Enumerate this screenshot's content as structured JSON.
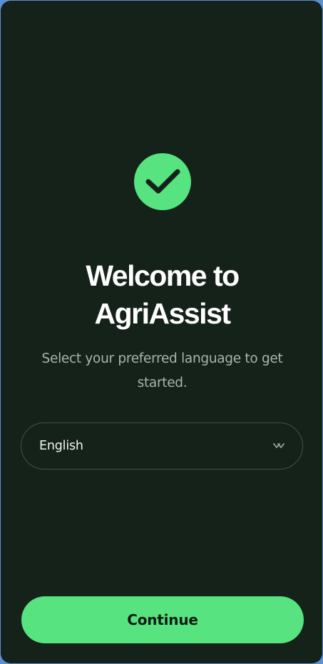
{
  "welcome": {
    "title_line1": "Welcome to",
    "title_line2": "AgriAssist",
    "subtitle_line1": "Select your preferred language to get",
    "subtitle_line2": "started."
  },
  "language_select": {
    "selected": "English",
    "icon": "chevron-down-icon"
  },
  "actions": {
    "continue_label": "Continue"
  },
  "icons": {
    "badge": "check-circle-icon"
  },
  "colors": {
    "background": "#15221a",
    "accent": "#57e37f",
    "title": "#ffffff",
    "subtitle": "#aab3ae",
    "select_border": "#3d5445",
    "button_text": "#0f1c14"
  }
}
